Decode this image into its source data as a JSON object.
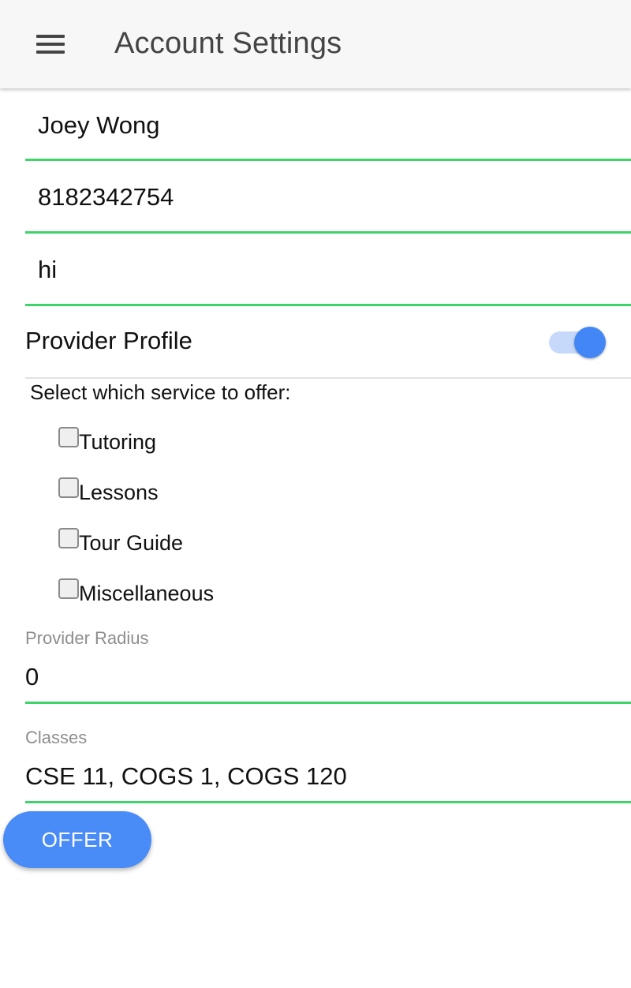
{
  "colors": {
    "accent": "#4287f5",
    "field_underline": "#3ed46a",
    "appbar_bg": "#f7f7f7"
  },
  "appbar": {
    "menu_icon": "hamburger-menu-icon",
    "title": "Account Settings"
  },
  "profile": {
    "name_value": "Joey Wong",
    "phone_value": "8182342754",
    "bio_value": "hi"
  },
  "provider_profile": {
    "label": "Provider Profile",
    "enabled": true
  },
  "services": {
    "title": "Select which service to offer:",
    "options": [
      {
        "label": "Tutoring",
        "checked": false
      },
      {
        "label": "Lessons",
        "checked": false
      },
      {
        "label": "Tour Guide",
        "checked": false
      },
      {
        "label": "Miscellaneous",
        "checked": false
      }
    ]
  },
  "provider_radius": {
    "label": "Provider Radius",
    "value": "0"
  },
  "classes": {
    "label": "Classes",
    "value": "CSE 11, COGS 1, COGS 120"
  },
  "offer_button": {
    "label": "OFFER"
  }
}
